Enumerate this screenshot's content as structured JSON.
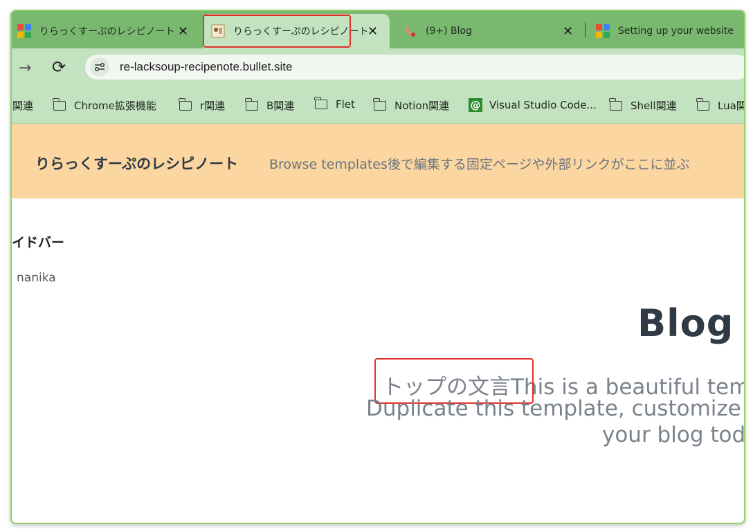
{
  "tabs": [
    {
      "title": "りらっくすーぷのレシピノート",
      "favicon": "bullet-logo-icon"
    },
    {
      "title": "りらっくすーぷのレシピノート",
      "favicon": "recipe-site-icon",
      "active": true
    },
    {
      "title": "(9+) Blog",
      "favicon": "hand-icon"
    },
    {
      "title": "Setting up your website",
      "favicon": "bullet-logo-icon"
    }
  ],
  "close_glyph": "✕",
  "toolbar": {
    "forward_glyph": "→",
    "reload_glyph": "⟳",
    "url": "re-lacksoup-recipenote.bullet.site"
  },
  "bookmarks": [
    {
      "label": "関連",
      "icon": "none"
    },
    {
      "label": "Chrome拡張機能",
      "icon": "folder-icon"
    },
    {
      "label": "r関連",
      "icon": "folder-icon"
    },
    {
      "label": "B関連",
      "icon": "folder-icon"
    },
    {
      "label": "Flet",
      "icon": "folder-icon"
    },
    {
      "label": "Notion関連",
      "icon": "folder-icon"
    },
    {
      "label": "Visual Studio Code...",
      "icon": "at-icon"
    },
    {
      "label": "Shell関連",
      "icon": "folder-icon"
    },
    {
      "label": "Lua関",
      "icon": "folder-icon"
    }
  ],
  "page": {
    "site_title": "りらっくすーぷのレシピノート",
    "header_links": "Browse templates後で編集する固定ページや外部リンクがここに並ぶ",
    "sidebar_title": "イドバー",
    "sidebar_item": "nanika",
    "blog_title": "Blog",
    "tagline_highlight": "トップの文言",
    "tagline_rest": "This is a beautiful temp",
    "tagline_line2": "Duplicate this template, customize the",
    "tagline_line3": "your blog toda"
  },
  "colors": {
    "tabstrip": "#79b96f",
    "toolbar": "#c3e2c0",
    "header_bg": "#fbd6a0",
    "highlight": "#e0322a",
    "window_border": "#8fd16a"
  }
}
